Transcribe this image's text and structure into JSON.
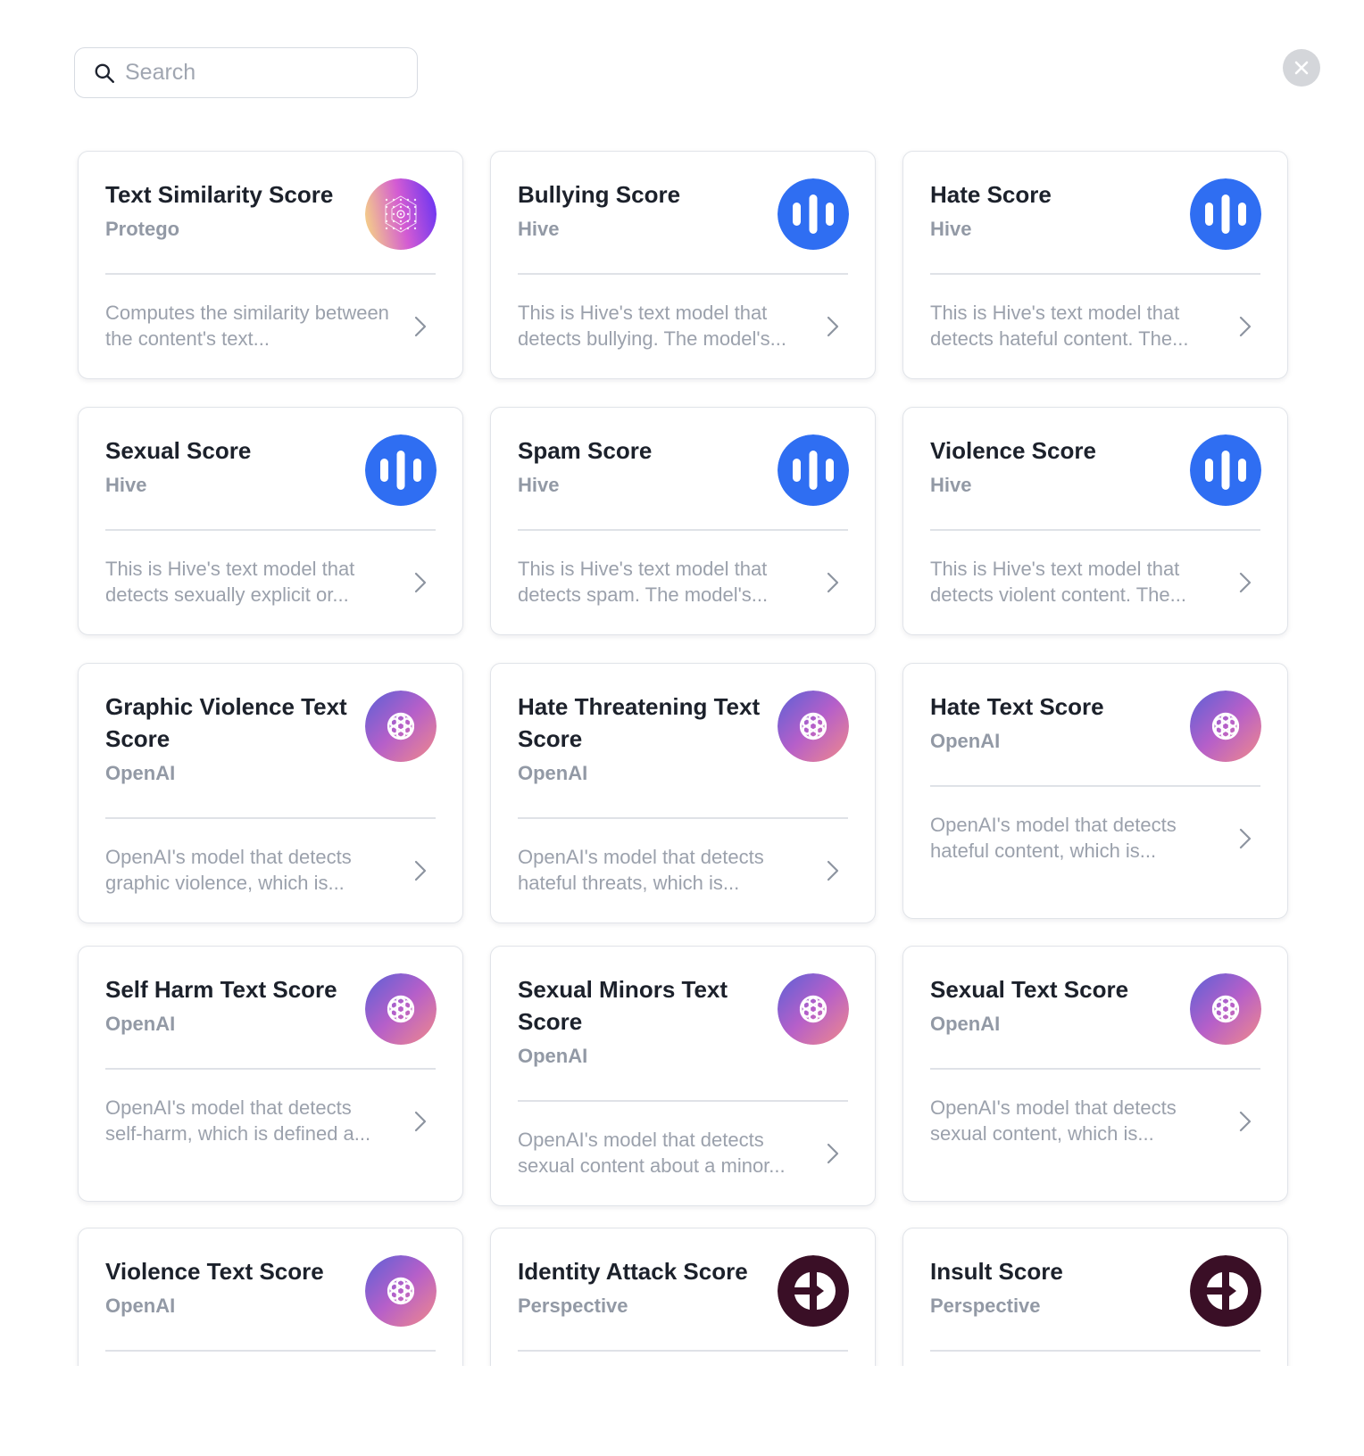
{
  "search": {
    "placeholder": "Search",
    "value": ""
  },
  "colors": {
    "hive_blue": "#2f6ef2",
    "perspective_maroon": "#3a0f26",
    "openai_gradient": [
      "#5b61d6",
      "#b65fc9",
      "#f08a8a"
    ],
    "protego_gradient": [
      "#f3c98b",
      "#d35bd3",
      "#6b35f2"
    ]
  },
  "cards": [
    {
      "title": "Text Similarity Score",
      "vendor": "Protego",
      "description": "Computes the similarity between the content's text...",
      "logo": "protego-logo-icon"
    },
    {
      "title": "Bullying Score",
      "vendor": "Hive",
      "description": "This is Hive's text model that detects bullying. The model's...",
      "logo": "hive-logo-icon"
    },
    {
      "title": "Hate Score",
      "vendor": "Hive",
      "description": "This is Hive's text model that detects hateful content. The...",
      "logo": "hive-logo-icon"
    },
    {
      "title": "Sexual Score",
      "vendor": "Hive",
      "description": "This is Hive's text model that detects sexually explicit or...",
      "logo": "hive-logo-icon"
    },
    {
      "title": "Spam Score",
      "vendor": "Hive",
      "description": "This is Hive's text model that detects spam. The model's...",
      "logo": "hive-logo-icon"
    },
    {
      "title": "Violence Score",
      "vendor": "Hive",
      "description": "This is Hive's text model that detects violent content. The...",
      "logo": "hive-logo-icon"
    },
    {
      "title": "Graphic Violence Text Score",
      "vendor": "OpenAI",
      "description": "OpenAI's model that detects graphic violence, which is...",
      "logo": "openai-logo-icon"
    },
    {
      "title": "Hate Threatening Text Score",
      "vendor": "OpenAI",
      "description": "OpenAI's model that detects hateful threats, which is...",
      "logo": "openai-logo-icon"
    },
    {
      "title": "Hate Text Score",
      "vendor": "OpenAI",
      "description": "OpenAI's model that detects hateful content, which is...",
      "logo": "openai-logo-icon"
    },
    {
      "title": "Self Harm Text Score",
      "vendor": "OpenAI",
      "description": "OpenAI's model that detects self-harm, which is defined a...",
      "logo": "openai-logo-icon"
    },
    {
      "title": "Sexual Minors Text Score",
      "vendor": "OpenAI",
      "description": "OpenAI's model that detects sexual content about a minor...",
      "logo": "openai-logo-icon"
    },
    {
      "title": "Sexual Text Score",
      "vendor": "OpenAI",
      "description": "OpenAI's model that detects sexual content, which is...",
      "logo": "openai-logo-icon"
    },
    {
      "title": "Violence Text Score",
      "vendor": "OpenAI",
      "description": "",
      "logo": "openai-logo-icon"
    },
    {
      "title": "Identity Attack Score",
      "vendor": "Perspective",
      "description": "",
      "logo": "perspective-logo-icon"
    },
    {
      "title": "Insult Score",
      "vendor": "Perspective",
      "description": "",
      "logo": "perspective-logo-icon"
    }
  ]
}
